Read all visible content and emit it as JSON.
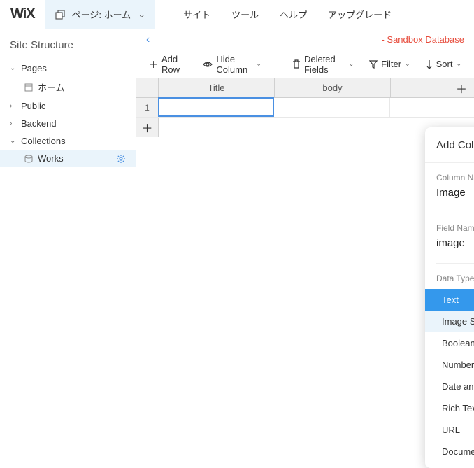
{
  "logo": "WiX",
  "pageSelector": {
    "label": "ページ: ホーム"
  },
  "topMenu": [
    "サイト",
    "ツール",
    "ヘルプ",
    "アップグレード"
  ],
  "sidebar": {
    "title": "Site Structure",
    "nodes": {
      "pages": {
        "label": "Pages",
        "expanded": true,
        "children": [
          {
            "label": "ホーム"
          }
        ]
      },
      "public": {
        "label": "Public",
        "expanded": false
      },
      "backend": {
        "label": "Backend",
        "expanded": false
      },
      "collections": {
        "label": "Collections",
        "expanded": true,
        "children": [
          {
            "label": "Works",
            "selected": true
          }
        ]
      }
    }
  },
  "mainHeader": {
    "sandbox": "- Sandbox Database"
  },
  "toolbar": {
    "addRow": "Add Row",
    "hideColumn": "Hide Column",
    "deletedFields": "Deleted Fields",
    "filter": "Filter",
    "sort": "Sort"
  },
  "grid": {
    "columns": [
      "Title",
      "body"
    ],
    "rows": [
      {
        "num": "1"
      }
    ]
  },
  "addColumnPopup": {
    "title": "Add Column",
    "columnName": {
      "label": "Column Name",
      "value": "Image"
    },
    "fieldName": {
      "label": "Field Name",
      "value": "image"
    },
    "dataType": {
      "label": "Data Type",
      "options": [
        "Text",
        "Image Source",
        "Boolean",
        "Number",
        "Date and Time",
        "Rich Text",
        "URL",
        "Document"
      ],
      "selected": "Text",
      "hovered": "Image Source"
    }
  },
  "glyphs": {
    "plus": "＋",
    "chevDown": "⌄",
    "chevRight": "›",
    "chevLeft": "‹",
    "close": "✕"
  }
}
